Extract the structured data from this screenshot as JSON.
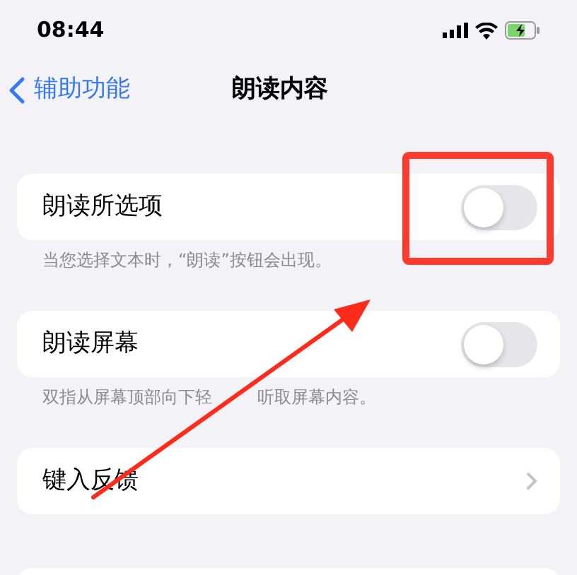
{
  "status_bar": {
    "time": "08:44"
  },
  "nav": {
    "back": "辅助功能",
    "title": "朗读内容"
  },
  "sections": [
    {
      "kind": "toggle",
      "label": "朗读所选项",
      "on": false,
      "footer": "当您选择文本时，“朗读”按钮会出现。"
    },
    {
      "kind": "toggle",
      "label": "朗读屏幕",
      "on": false,
      "footer_parts": [
        "双指从屏幕顶部向下轻",
        "听取屏幕内容。"
      ]
    },
    {
      "kind": "link",
      "label": "键入反馈"
    },
    {
      "kind": "blank"
    }
  ]
}
